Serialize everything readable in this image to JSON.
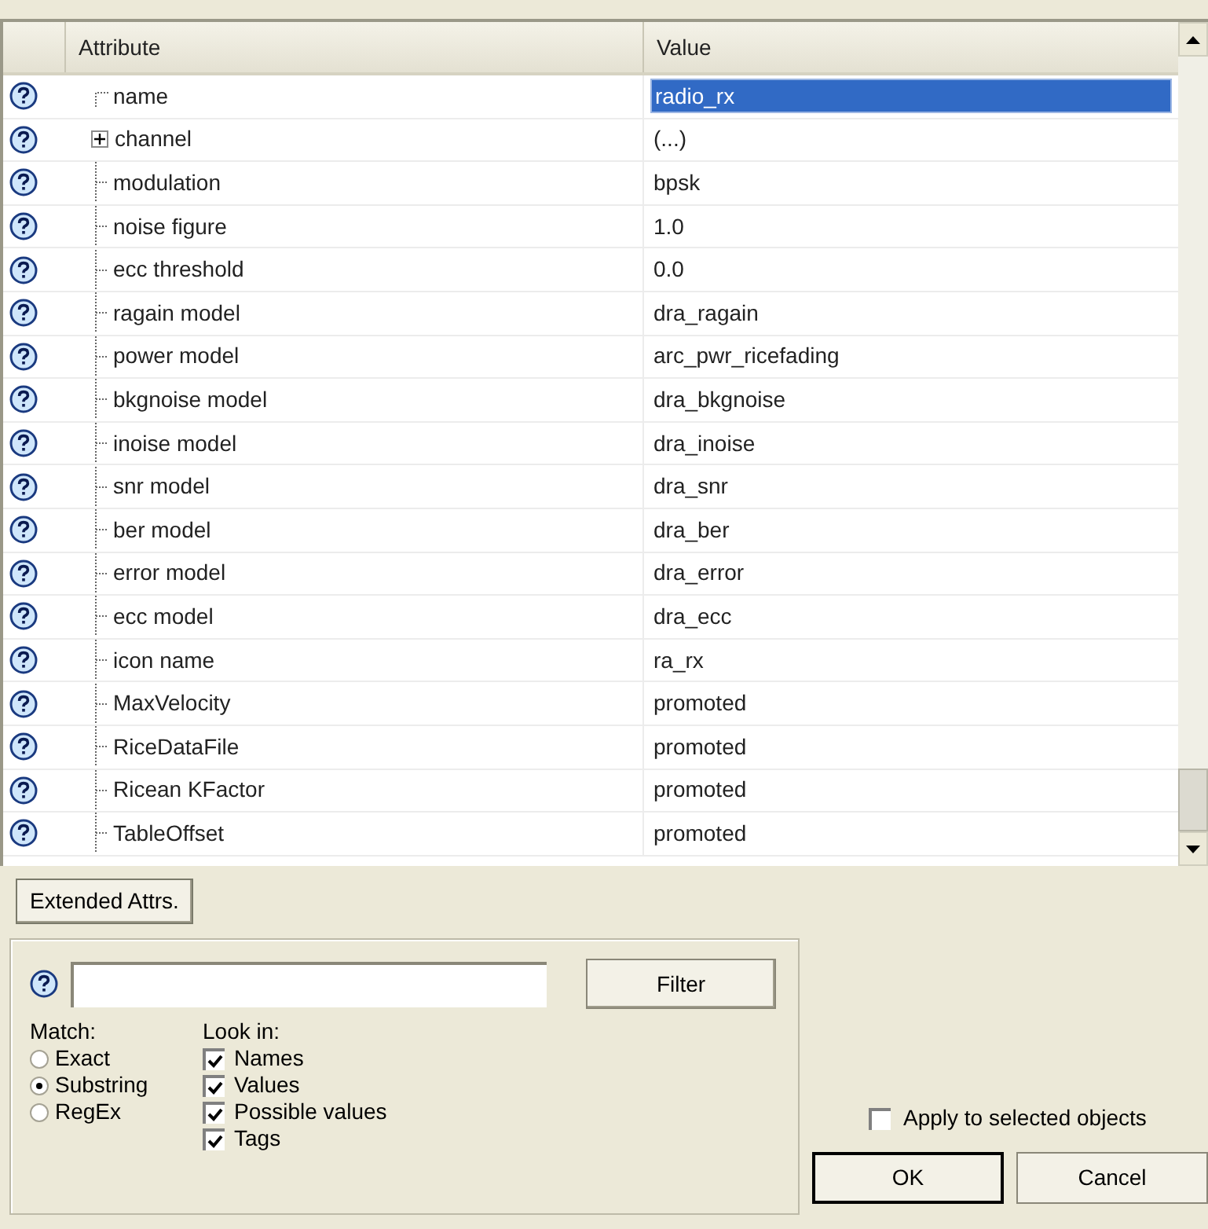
{
  "table": {
    "columns": [
      "Attribute",
      "Value"
    ],
    "rows": [
      {
        "attribute": "name",
        "value": "radio_rx",
        "kind": "first",
        "selected": true
      },
      {
        "attribute": "channel",
        "value": "(...)",
        "kind": "group",
        "expanded": false,
        "selected": false
      },
      {
        "attribute": "modulation",
        "value": "bpsk",
        "kind": "leaf",
        "selected": false
      },
      {
        "attribute": "noise figure",
        "value": "1.0",
        "kind": "leaf",
        "selected": false
      },
      {
        "attribute": "ecc threshold",
        "value": "0.0",
        "kind": "leaf",
        "selected": false
      },
      {
        "attribute": "ragain model",
        "value": "dra_ragain",
        "kind": "leaf",
        "selected": false
      },
      {
        "attribute": "power model",
        "value": "arc_pwr_ricefading",
        "kind": "leaf",
        "selected": false
      },
      {
        "attribute": "bkgnoise model",
        "value": "dra_bkgnoise",
        "kind": "leaf",
        "selected": false
      },
      {
        "attribute": "inoise model",
        "value": "dra_inoise",
        "kind": "leaf",
        "selected": false
      },
      {
        "attribute": "snr model",
        "value": "dra_snr",
        "kind": "leaf",
        "selected": false
      },
      {
        "attribute": "ber model",
        "value": "dra_ber",
        "kind": "leaf",
        "selected": false
      },
      {
        "attribute": "error model",
        "value": "dra_error",
        "kind": "leaf",
        "selected": false
      },
      {
        "attribute": "ecc model",
        "value": "dra_ecc",
        "kind": "leaf",
        "selected": false
      },
      {
        "attribute": "icon name",
        "value": "ra_rx",
        "kind": "leaf",
        "selected": false
      },
      {
        "attribute": "MaxVelocity",
        "value": "promoted",
        "kind": "leaf",
        "selected": false
      },
      {
        "attribute": "RiceDataFile",
        "value": "promoted",
        "kind": "leaf",
        "selected": false
      },
      {
        "attribute": "Ricean KFactor",
        "value": "promoted",
        "kind": "leaf",
        "selected": false
      },
      {
        "attribute": "TableOffset",
        "value": "promoted",
        "kind": "leaf",
        "selected": false
      }
    ]
  },
  "extended_button": "Extended Attrs.",
  "filter": {
    "button": "Filter",
    "match_label": "Match:",
    "match": [
      {
        "label": "Exact",
        "selected": false
      },
      {
        "label": "Substring",
        "selected": true
      },
      {
        "label": "RegEx",
        "selected": false
      }
    ],
    "look_in_label": "Look in:",
    "look_in": [
      {
        "label": "Names",
        "checked": true
      },
      {
        "label": "Values",
        "checked": true
      },
      {
        "label": "Possible values",
        "checked": true
      },
      {
        "label": "Tags",
        "checked": true
      }
    ]
  },
  "apply": {
    "label": "Apply to selected objects",
    "checked": false
  },
  "buttons": [
    "OK",
    "Cancel"
  ]
}
